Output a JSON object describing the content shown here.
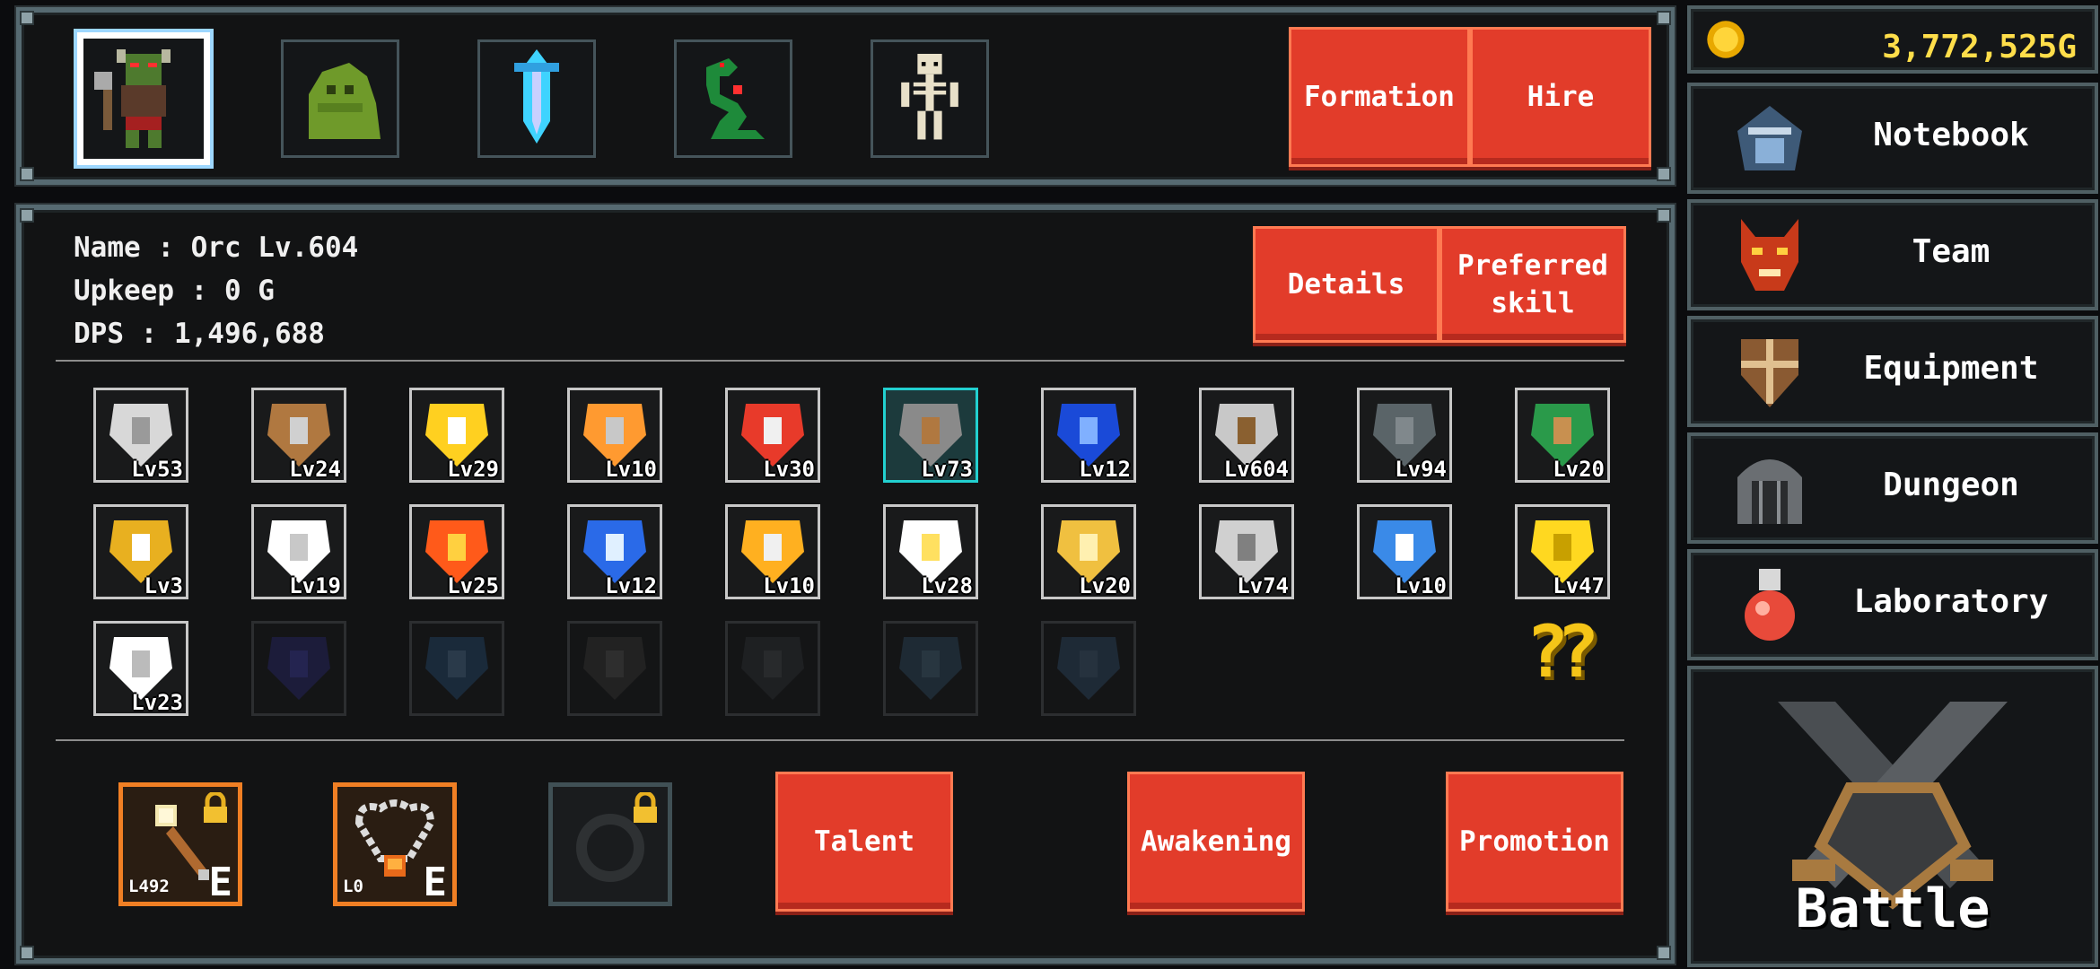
{
  "roster": {
    "units": [
      {
        "icon": "orc-icon",
        "selected": true
      },
      {
        "icon": "slime-icon",
        "selected": false
      },
      {
        "icon": "crystal-sword-icon",
        "selected": false
      },
      {
        "icon": "serpent-icon",
        "selected": false
      },
      {
        "icon": "skeleton-icon",
        "selected": false
      }
    ],
    "formation_label": "Formation",
    "hire_label": "Hire"
  },
  "unit": {
    "name_line": "Name : Orc Lv.604",
    "upkeep_line": "Upkeep : 0 G",
    "dps_line": "DPS : 1,496,688",
    "details_label": "Details",
    "preferred_label_1": "Preferred",
    "preferred_label_2": "skill"
  },
  "skills": [
    {
      "icon": "shield-icon",
      "level": "Lv53"
    },
    {
      "icon": "pickaxe-icon",
      "level": "Lv24"
    },
    {
      "icon": "atk-up-icon",
      "level": "Lv29"
    },
    {
      "icon": "burning-shield-icon",
      "level": "Lv10"
    },
    {
      "icon": "rocket-sword-icon",
      "level": "Lv30"
    },
    {
      "icon": "hammer-icon",
      "level": "Lv73",
      "highlight": true
    },
    {
      "icon": "blue-burst-icon",
      "level": "Lv12"
    },
    {
      "icon": "axe-icon",
      "level": "Lv604"
    },
    {
      "icon": "stone-icon",
      "level": "Lv94"
    },
    {
      "icon": "crossed-arrows-icon",
      "level": "Lv20"
    },
    {
      "icon": "golden-bomb-icon",
      "level": "Lv3"
    },
    {
      "icon": "white-flame-icon",
      "level": "Lv19"
    },
    {
      "icon": "fire-icon",
      "level": "Lv25"
    },
    {
      "icon": "blue-bell-icon",
      "level": "Lv12"
    },
    {
      "icon": "sword-burst-icon",
      "level": "Lv10"
    },
    {
      "icon": "star-burst-icon",
      "level": "Lv28"
    },
    {
      "icon": "golden-blade-icon",
      "level": "Lv20"
    },
    {
      "icon": "cracked-shield-icon",
      "level": "Lv74"
    },
    {
      "icon": "blue-ghost-icon",
      "level": "Lv10"
    },
    {
      "icon": "yellow-arrow-icon",
      "level": "Lv47"
    },
    {
      "icon": "ring-icon",
      "level": "Lv23"
    },
    {
      "icon": "dark-orb-icon",
      "locked": true
    },
    {
      "icon": "dark-sword-icon",
      "locked": true
    },
    {
      "icon": "dark-staff-icon",
      "locked": true
    },
    {
      "icon": "dark-sphere-icon",
      "locked": true
    },
    {
      "icon": "dark-heart-icon",
      "locked": true
    },
    {
      "icon": "dark-armor-icon",
      "locked": true
    }
  ],
  "mystery": "??",
  "equipment": [
    {
      "icon": "staff-icon",
      "code": "L492",
      "mark": "E",
      "locked_badge": true
    },
    {
      "icon": "necklace-icon",
      "code": "L0",
      "mark": "E",
      "locked_badge": false
    },
    {
      "icon": "ring-slot-icon",
      "code": "",
      "mark": "",
      "locked_badge": true,
      "empty": true
    }
  ],
  "actions": {
    "talent": "Talent",
    "awakening": "Awakening",
    "promotion": "Promotion"
  },
  "sidebar": {
    "gold": "3,772,525G",
    "items": [
      {
        "label": "Notebook",
        "icon": "notebook-icon"
      },
      {
        "label": "Team",
        "icon": "demon-mask-icon"
      },
      {
        "label": "Equipment",
        "icon": "shield-emblem-icon"
      },
      {
        "label": "Dungeon",
        "icon": "dungeon-gate-icon"
      },
      {
        "label": "Laboratory",
        "icon": "potion-icon"
      }
    ],
    "battle": "Battle"
  },
  "colors": {
    "accent_red": "#e23c2a",
    "gold_text": "#ffde4a",
    "panel_border": "#566a71"
  }
}
